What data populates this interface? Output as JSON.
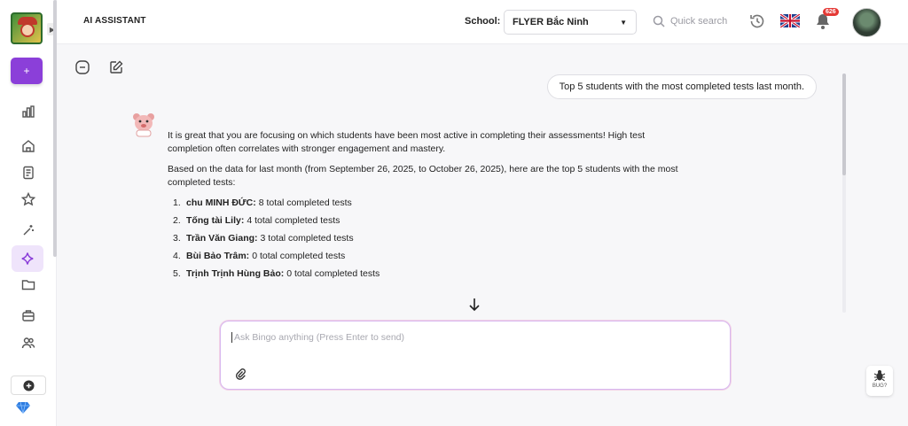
{
  "header": {
    "title": "AI ASSISTANT",
    "school_label": "School:",
    "school_value": "FLYER Bắc Ninh",
    "search_placeholder": "Quick search",
    "notification_count": "626"
  },
  "sidebar": {
    "new_label": "+",
    "items": [
      {
        "icon": "chart-bar-icon"
      },
      {
        "icon": "home-icon"
      },
      {
        "icon": "document-icon"
      },
      {
        "icon": "star-icon"
      },
      {
        "icon": "magic-wand-icon"
      },
      {
        "icon": "sparkle-icon",
        "active": true
      },
      {
        "icon": "folder-icon"
      },
      {
        "icon": "briefcase-icon"
      },
      {
        "icon": "users-icon"
      }
    ]
  },
  "chat": {
    "user_message": "Top 5 students with the most completed tests last month.",
    "bot_paragraph_1": "It is great that you are focusing on which students have been most active in completing their assessments! High test completion often correlates with stronger engagement and mastery.",
    "bot_paragraph_2": "Based on the data for last month (from September 26, 2025, to October 26, 2025), here are the top 5 students with the most completed tests:",
    "students": [
      {
        "num": "1.",
        "name": "chu MINH ĐỨC:",
        "detail": "8 total completed tests"
      },
      {
        "num": "2.",
        "name": "Tống tài Lily:",
        "detail": "4 total completed tests"
      },
      {
        "num": "3.",
        "name": "Trần Văn Giang:",
        "detail": "3 total completed tests"
      },
      {
        "num": "4.",
        "name": "Bùi Bảo Trâm:",
        "detail": "0 total completed tests"
      },
      {
        "num": "5.",
        "name": "Trịnh Trịnh Hùng Bảo:",
        "detail": "0 total completed tests"
      }
    ]
  },
  "input": {
    "placeholder": "Ask Bingo anything (Press Enter to send)"
  },
  "bug_label": "BUG?",
  "colors": {
    "accent": "#8b3fd9",
    "active_bg": "#efe4fb",
    "badge": "#e53935"
  }
}
